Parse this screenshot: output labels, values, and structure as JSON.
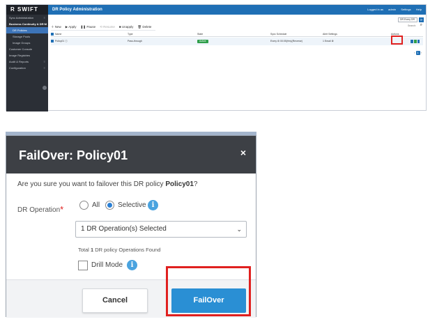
{
  "app": {
    "logo": "R SWIFT",
    "title": "DR Policy Administration",
    "user": {
      "logged_in": "Logged in as",
      "name": "admin",
      "settings": "Settings",
      "help": "Help"
    },
    "sidebar": {
      "items": [
        {
          "label": "Sync Administration",
          "caret": "≡"
        },
        {
          "label": "Business Continuity & DR M",
          "caret": "≡"
        },
        {
          "label": "DR Policies"
        },
        {
          "label": "Storage Pools"
        },
        {
          "label": "Image Groups"
        },
        {
          "label": "Customer Console",
          "caret": ""
        },
        {
          "label": "Image Registries",
          "caret": ""
        },
        {
          "label": "Audit & Reports",
          "caret": "≡"
        },
        {
          "label": "Configuration",
          "caret": "≡"
        }
      ]
    },
    "filter": {
      "value": "DR Every DR",
      "search": "Search:"
    },
    "toolbar": [
      "New",
      "Apply",
      "Pause",
      "Resume",
      "Unapply",
      "Delete"
    ],
    "grid": {
      "columns": [
        "Name",
        "Type",
        "State",
        "Sync Schedule",
        "Alert Settings",
        "Actions"
      ],
      "row": {
        "name": "Policy01 ⓘ",
        "type": "Pass-through",
        "state": "Active",
        "schedule": "Every ⚙ 00:05(Hrs)(Reverse)",
        "alerts": "1 Email ⚙"
      }
    },
    "pager": {
      "current": "1"
    }
  },
  "dialog": {
    "title": "FailOver: Policy01",
    "close": "×",
    "question_prefix": "Are you sure you want to failover this DR policy ",
    "policy": "Policy01",
    "question_suffix": "?",
    "dr_operation_label": "DR Operation",
    "required_mark": "*",
    "option_all": "All",
    "option_selective": "Selective",
    "info": "i",
    "select_value": "1 DR Operation(s) Selected",
    "chevron": "⌄",
    "found_prefix": "Total ",
    "found_count": "1",
    "found_suffix": " DR policy Operations Found",
    "drill_mode": "Drill Mode",
    "cancel": "Cancel",
    "failover": "FailOver"
  },
  "colors": {
    "primary": "#2a8fd4",
    "highlight": "#e0201f",
    "header": "#3d4045",
    "active": "#2e9e4a"
  }
}
